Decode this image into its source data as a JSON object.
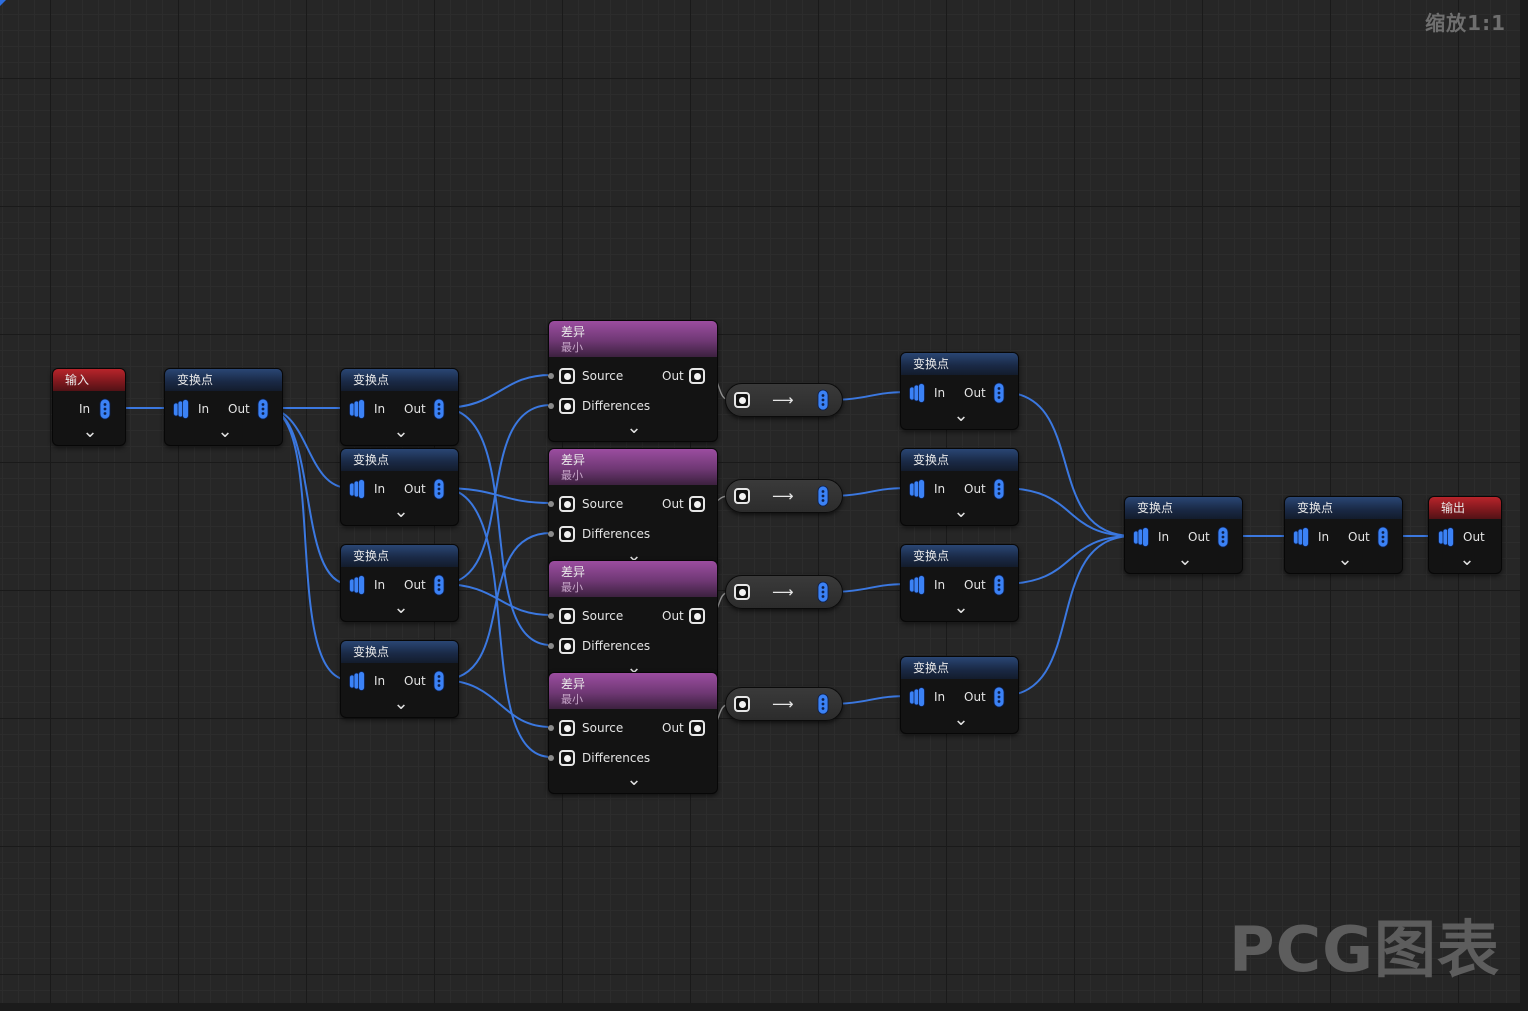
{
  "graph": {
    "zoom_label": "缩放1:1",
    "watermark": "PCG图表"
  },
  "nodes": {
    "input": {
      "title": "输入",
      "in_label": "In"
    },
    "output": {
      "title": "输出",
      "out_label": "Out"
    },
    "transform": {
      "title": "变换点",
      "in_label": "In",
      "out_label": "Out"
    },
    "difference": {
      "title": "差异",
      "subtitle": "最小",
      "source_label": "Source",
      "differences_label": "Differences",
      "out_label": "Out"
    }
  },
  "icons": {
    "expand": "chevron-down-icon",
    "reroute": "arrow-right-icon",
    "point_pin": "point-data-pin-icon",
    "spatial_pin": "spatial-data-pin-icon"
  },
  "colors": {
    "background": "#262626",
    "wire": "#3b78e0",
    "header_transform": "#2a4674",
    "header_io": "#b8242b",
    "header_difference": "#9b4da0",
    "pin": "#3b82f6"
  }
}
